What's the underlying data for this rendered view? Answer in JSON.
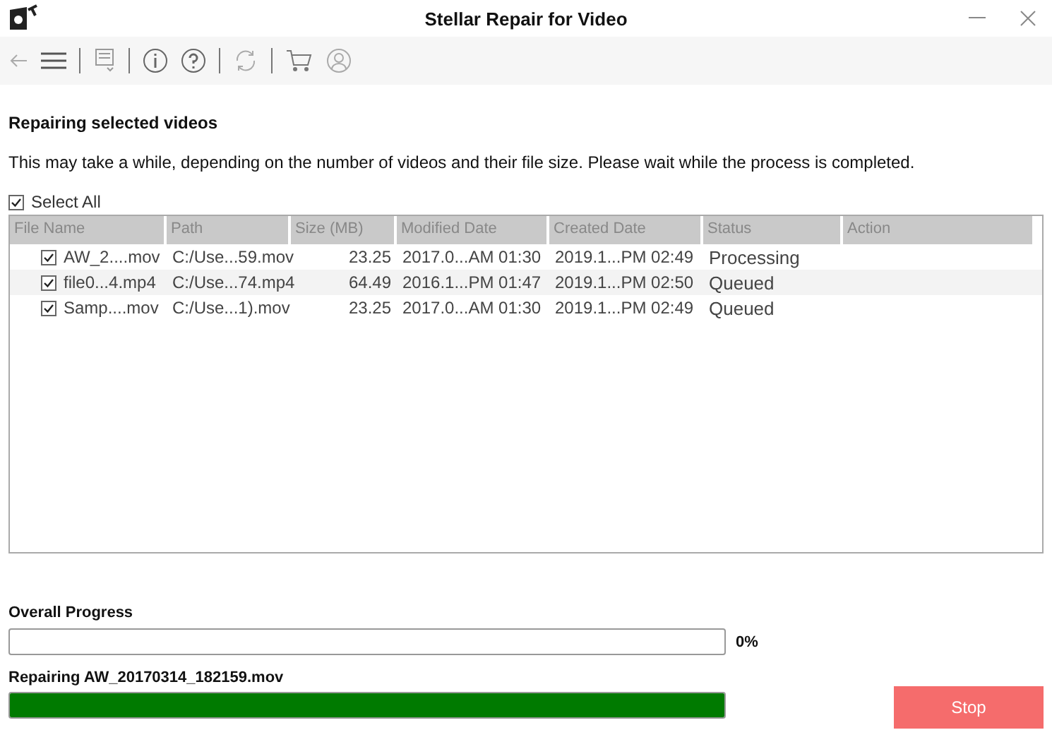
{
  "window": {
    "title": "Stellar Repair for Video"
  },
  "heading": "Repairing selected videos",
  "description": "This may take a while, depending on the number of videos and their file size. Please wait while the process is completed.",
  "select_all": {
    "label": "Select All",
    "checked": true
  },
  "table": {
    "columns": [
      "File Name",
      "Path",
      "Size (MB)",
      "Modified Date",
      "Created Date",
      "Status",
      "Action"
    ],
    "rows": [
      {
        "checked": true,
        "cells": [
          "AW_2....mov",
          "C:/Use...59.mov",
          "23.25",
          "2017.0...AM 01:30",
          "2019.1...PM 02:49",
          "Processing"
        ]
      },
      {
        "checked": true,
        "cells": [
          "file0...4.mp4",
          "C:/Use...74.mp4",
          "64.49",
          "2016.1...PM 01:47",
          "2019.1...PM 02:50",
          "Queued"
        ]
      },
      {
        "checked": true,
        "cells": [
          "Samp....mov",
          "C:/Use...1).mov",
          "23.25",
          "2017.0...AM 01:30",
          "2019.1...PM 02:49",
          "Queued"
        ]
      }
    ]
  },
  "overall": {
    "label": "Overall Progress",
    "level": 0,
    "reading": "0%"
  },
  "current": {
    "label": "Repairing AW_20170314_182159.mov",
    "level": 1
  },
  "stop_button": "Stop"
}
